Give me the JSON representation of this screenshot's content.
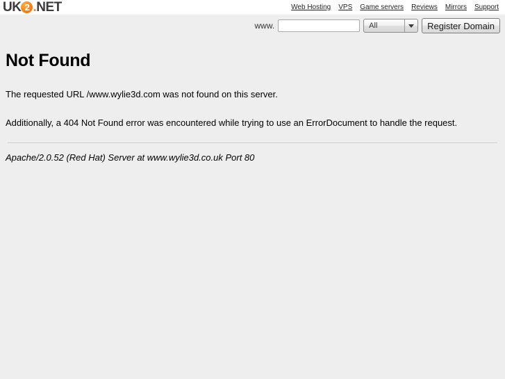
{
  "header": {
    "logo": {
      "prefix": "UK",
      "badge_digit": "2",
      "dot": ".",
      "suffix": "NET",
      "accent_color": "#f58220",
      "text_color": "#3b3b3b"
    },
    "nav_links": [
      {
        "label": "Web Hosting",
        "name": "nav-web-hosting"
      },
      {
        "label": "VPS",
        "name": "nav-vps"
      },
      {
        "label": "Game servers",
        "name": "nav-game-servers"
      },
      {
        "label": "Reviews",
        "name": "nav-reviews"
      },
      {
        "label": "Mirrors",
        "name": "nav-mirrors"
      },
      {
        "label": "Support",
        "name": "nav-support"
      }
    ]
  },
  "search": {
    "www_label": "www.",
    "domain_value": "",
    "domain_placeholder": "",
    "tld_selected": "All",
    "tld_options": [
      "All"
    ],
    "register_label": "Register Domain"
  },
  "main": {
    "title": "Not Found",
    "paragraph_1": "The requested URL /www.wylie3d.com was not found on this server.",
    "paragraph_2": "Additionally, a 404 Not Found error was encountered while trying to use an ErrorDocument to handle the request.",
    "server_signature": "Apache/2.0.52 (Red Hat) Server at www.wylie3d.co.uk Port 80"
  }
}
